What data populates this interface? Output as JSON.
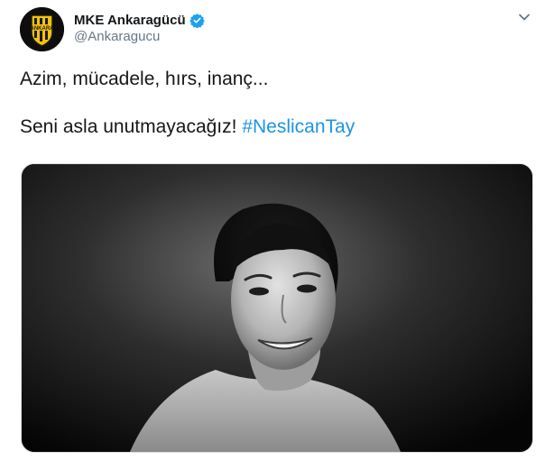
{
  "author": {
    "display_name": "MKE Ankaragücü",
    "handle": "@Ankaragucu",
    "avatar_icon": "club-crest-icon",
    "verified_icon": "verified-badge-icon",
    "verified_color": "#1da1f2"
  },
  "menu_icon": "chevron-down-icon",
  "tweet": {
    "line1": "Azim, mücadele, hırs, inanç...",
    "line2_text": "Seni asla unutmayacağız! ",
    "hashtag": "#NeslicanTay",
    "hashtag_color": "#1b95e0"
  },
  "media": {
    "type": "black-and-white portrait photo"
  }
}
